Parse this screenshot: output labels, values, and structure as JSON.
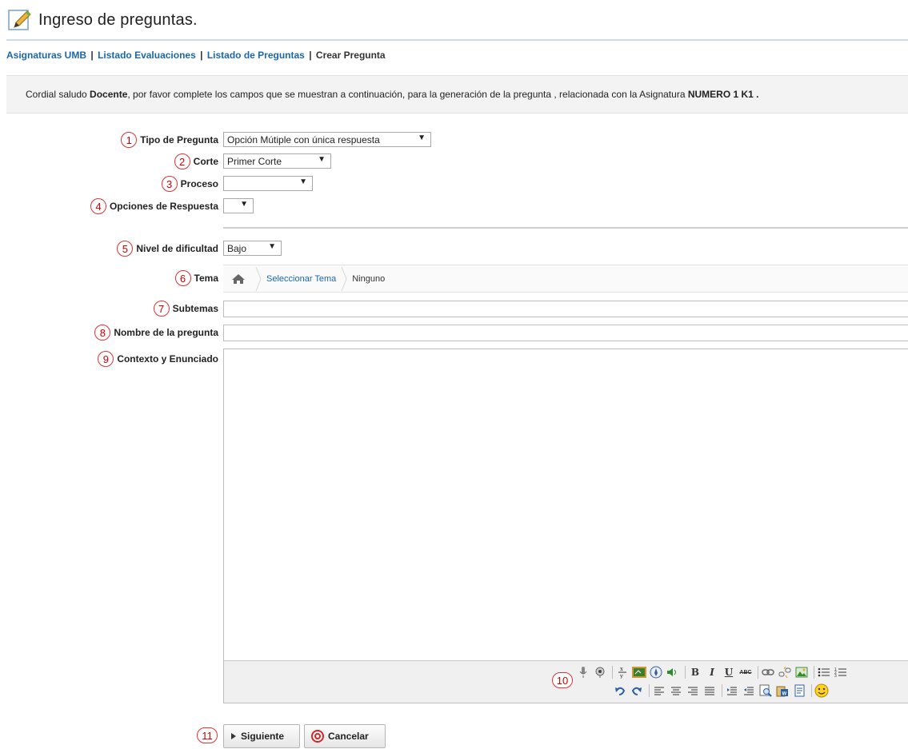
{
  "header": {
    "title": "Ingreso de preguntas.",
    "icon": "pencil-icon"
  },
  "breadcrumb": {
    "items": [
      "Asignaturas UMB",
      "Listado Evaluaciones",
      "Listado de Preguntas"
    ],
    "current": "Crear Pregunta",
    "separator": "|"
  },
  "notice": {
    "part1": "Cordial saludo ",
    "bold1": "Docente",
    "part2": ", por favor complete los campos que se muestran a continuación, para la generación de la pregunta , relacionada con la Asignatura ",
    "bold2": "NUMERO 1 K1 ."
  },
  "form": {
    "tipo": {
      "num": "1",
      "label": "Tipo de Pregunta",
      "value": "Opción Mútiple con única respuesta"
    },
    "corte": {
      "num": "2",
      "label": "Corte",
      "value": "Primer Corte"
    },
    "proceso": {
      "num": "3",
      "label": "Proceso",
      "value": ""
    },
    "opciones": {
      "num": "4",
      "label": "Opciones de Respuesta",
      "value": ""
    },
    "nivel": {
      "num": "5",
      "label": "Nivel de dificultad",
      "value": "Bajo"
    },
    "tema": {
      "num": "6",
      "label": "Tema",
      "link": "Seleccionar Tema",
      "value": "Ninguno"
    },
    "subtemas": {
      "num": "7",
      "label": "Subtemas",
      "value": ""
    },
    "nombre": {
      "num": "8",
      "label": "Nombre de la pregunta",
      "value": ""
    },
    "contexto": {
      "num": "9",
      "label": "Contexto y Enunciado",
      "value": ""
    }
  },
  "editor": {
    "toolbar_num": "10",
    "toolbar_row1": [
      "microphone-icon",
      "record-icon",
      "fraction-icon",
      "chalkboard-icon",
      "compass-icon",
      "speaker-icon",
      "bold-icon",
      "italic-icon",
      "underline-icon",
      "strikethrough-icon",
      "link-icon",
      "unlink-icon",
      "image-icon",
      "bullet-list-icon",
      "numbered-list-icon"
    ],
    "toolbar_row2": [
      "undo-icon",
      "redo-icon",
      "align-left-icon",
      "align-center-icon",
      "align-right-icon",
      "align-justify-icon",
      "outdent-icon",
      "indent-icon",
      "preview-icon",
      "paste-word-icon",
      "paste-text-icon",
      "smiley-icon"
    ],
    "format_letters": {
      "bold": "B",
      "italic": "I",
      "underline": "U",
      "strike": "ABC"
    }
  },
  "actions": {
    "num": "11",
    "next_label": "Siguiente",
    "cancel_label": "Cancelar"
  },
  "colors": {
    "link": "#1a67b0",
    "badge": "#cc0000",
    "header_line": "#c9ddef"
  },
  "select_arrow": "▼"
}
